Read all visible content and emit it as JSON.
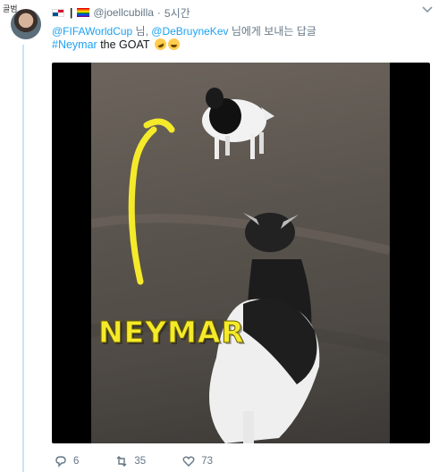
{
  "corner_label": "골범",
  "tweet": {
    "handle": "@joellcubilla",
    "separator": "|",
    "dot": "·",
    "time": "5시간",
    "reply": {
      "mention_1": "@FIFAWorldCup",
      "connector": " 님, ",
      "mention_2": "@DeBruyneKev",
      "suffix": " 님에게 보내는 답글"
    },
    "text": {
      "hashtag": "#Neymar",
      "body": " the GOAT "
    }
  },
  "video": {
    "caption": "NEYMAR"
  },
  "actions": {
    "reply_count": "6",
    "retweet_count": "35",
    "like_count": "73"
  },
  "colors": {
    "link": "#1da1f2",
    "muted": "#657786",
    "caption_yellow": "#f5ea2a"
  },
  "icons": [
    "panama-flag-icon",
    "rainbow-flag-icon",
    "chevron-down-icon",
    "rofl-emoji-icon",
    "joy-emoji-icon",
    "reply-icon",
    "retweet-icon",
    "heart-icon"
  ]
}
